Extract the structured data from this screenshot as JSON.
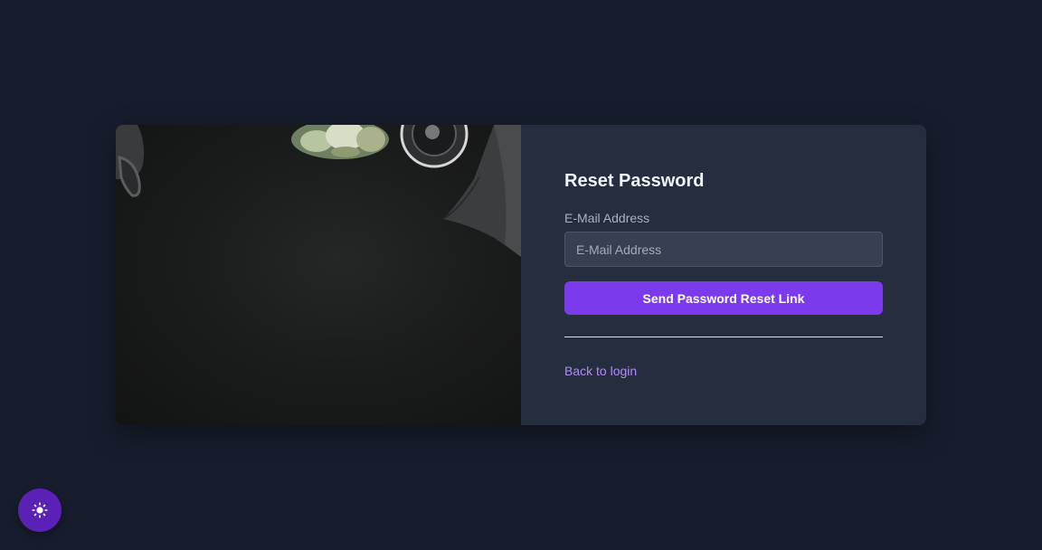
{
  "form": {
    "title": "Reset Password",
    "email_label": "E-Mail Address",
    "email_placeholder": "E-Mail Address",
    "email_value": "",
    "submit_label": "Send Password Reset Link",
    "back_link_label": "Back to login"
  },
  "theme_toggle": {
    "icon": "sun-icon"
  },
  "colors": {
    "background": "#171d2c",
    "panel": "#252d3f",
    "accent": "#7c3aed",
    "link": "#b08cf6"
  }
}
